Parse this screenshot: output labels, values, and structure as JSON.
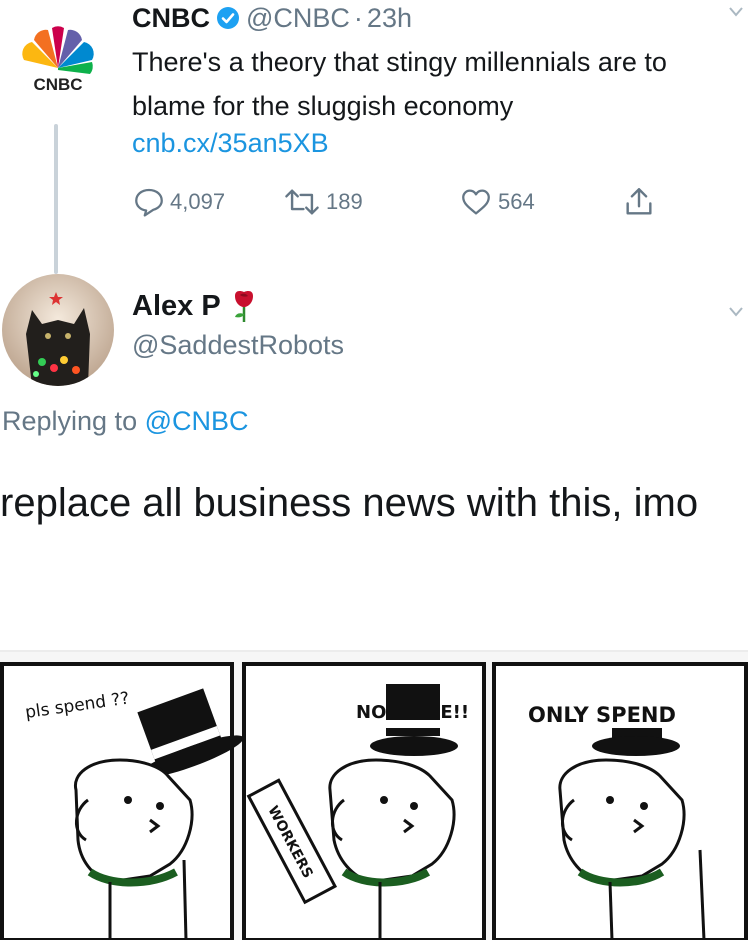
{
  "quoted_tweet": {
    "account_name": "CNBC",
    "handle": "@CNBC",
    "separator": "·",
    "time": "23h",
    "avatar_label": "CNBC",
    "text": "There's a theory that stingy millennials are to blame for the sluggish economy",
    "link": "cnb.cx/35an5XB",
    "replies": "4,097",
    "retweets": "189",
    "likes": "564"
  },
  "reply": {
    "name": "Alex P",
    "handle": "@SaddestRobots",
    "replying_prefix": "Replying to",
    "replying_to": "@CNBC",
    "text": "replace all business news with this, imo"
  },
  "comic": {
    "panels": [
      {
        "caption": "pls spend ??"
      },
      {
        "caption": "NO WAGE!!",
        "sign": "WORKERS"
      },
      {
        "caption": "ONLY SPEND"
      }
    ]
  }
}
